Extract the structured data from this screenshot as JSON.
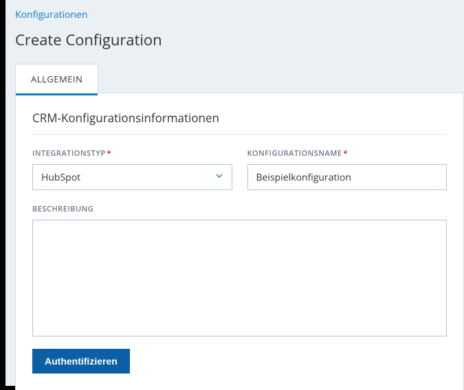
{
  "breadcrumb": {
    "configurations_link": "Konfigurationen"
  },
  "page": {
    "title": "Create Configuration"
  },
  "tabs": {
    "general": "ALLGEMEIN"
  },
  "section": {
    "heading": "CRM-Konfigurationsinformationen"
  },
  "form": {
    "integration_type_label": "INTEGRATIONSTYP",
    "integration_type_value": "HubSpot",
    "config_name_label": "KONFIGURATIONSNAME",
    "config_name_value": "Beispielkonfiguration",
    "description_label": "BESCHREIBUNG",
    "description_value": ""
  },
  "buttons": {
    "authenticate": "Authentifizieren"
  },
  "required_marker": "*"
}
